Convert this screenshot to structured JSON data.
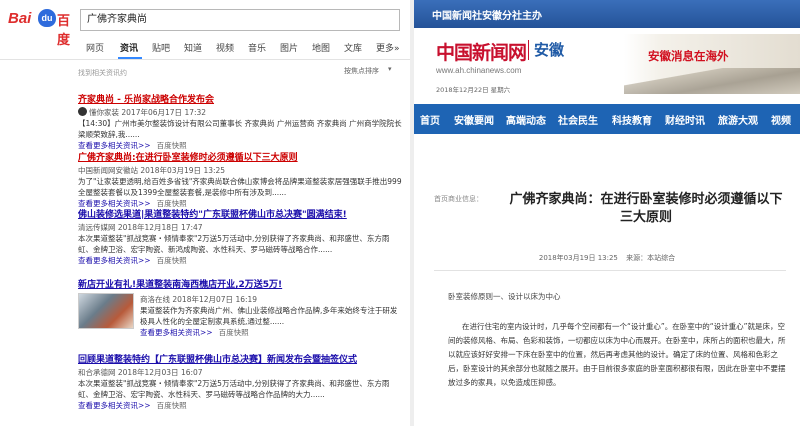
{
  "left": {
    "logo": {
      "bai": "Bai",
      "paw": "du",
      "du": "百度"
    },
    "search": {
      "value": "广佛齐家典尚"
    },
    "nav": [
      "网页",
      "资讯",
      "贴吧",
      "知道",
      "视频",
      "音乐",
      "图片",
      "地图",
      "文库",
      "更多»"
    ],
    "nav_active": "资讯",
    "result_meta": "找到相关资讯约",
    "sort": "按焦点排序",
    "sort_arrow": "▾",
    "results": [
      {
        "title": "齐家典尚 - 乐尚家战略合作发布会",
        "source": "懂你家装   2017年06月17日  17:32",
        "snippet": "【14:30】广州市美尔整装饰设计有限公司董事长 齐家典尚 广州运营商 齐家典尚 广州商学院院长 梁顺荣致辞,我......",
        "more": "查看更多相关资讯>>",
        "cache": "百度快照"
      },
      {
        "title": "广佛齐家典尚:在进行卧室装修时必须遵循以下三大原则",
        "source": "中国新闻网安徽站   2018年03月19日  13:25",
        "snippet": "为了\"让家装更透明,给百姓多省钱\"齐家典尚联合佛山家博会将品牌果道整装家居强强联手推出999全屋整装套餐以及1399全屋整装套餐,是装修中所有涉及到......",
        "more": "查看更多相关资讯>>",
        "cache": "百度快照"
      },
      {
        "title": "佛山装修选果道|果道整装特约\"广东联盟杯佛山市总决赛\"圆满结束!",
        "source": "清远传媒网   2018年12月18日  17:47",
        "snippet": "本次果道整装\"抓战竞赛・倾情奉家\"2万送5万活动中,分别获得了齐家典尚、和邦盛世、东方雨虹、金牌卫浴、宏宇陶瓷、新鸿成陶瓷、水性科天、罗马磁砖等战略合作......",
        "more": "查看更多相关资讯>>",
        "cache": "百度快照"
      },
      {
        "title": "新店开业有礼!果道整装南海西樵店开业,2万送5万!",
        "source": "商洛在线   2018年12月07日  16:19",
        "snippet": "果道整装作为齐家典尚广州、佛山业装修战略合作品牌,多年来始终专注于研发极具人性化的全屋定制家具系统,通过整......",
        "more": "查看更多相关资讯>>",
        "cache": "百度快照"
      },
      {
        "title": "回顾果道整装特约【广东联盟杯佛山市总决赛】新闻发布会暨抽签仪式",
        "source": "和合承德网   2018年12月03日  16:07",
        "snippet": "本次果道整装\"抓战竞赛・倾情奉家\"2万送5万活动中,分别获得了齐家典尚、和邦盛世、东方雨虹、金牌卫浴、宏宇陶瓷、水性科天、罗马磁砖等战略合作品牌的大力......",
        "more": "查看更多相关资讯>>",
        "cache": "百度快照"
      }
    ]
  },
  "right": {
    "topbar": "中国新闻社安徽分社主办",
    "logo": "中国新闻网",
    "province": "安徽",
    "url": "www.ah.chinanews.com",
    "date": "2018年12月22日  星期六",
    "banner": "安徽消息在海外",
    "nav": [
      "首页",
      "安徽要闻",
      "高端动态",
      "社会民生",
      "科技教育",
      "财经时讯",
      "旅游大观",
      "视频"
    ],
    "crumb": "首页商业信息：",
    "article": {
      "title": "广佛齐家典尚：在进行卧室装修时必须遵循以下三大原则",
      "date": "2018年03月19日 13:25",
      "source": "来源：本站综合",
      "subheading": "卧室装修原则一、设计以床为中心",
      "body": "在进行住宅的室内设计时，几乎每个空间都有一个“设计重心”。在卧室中的“设计重心”就是床，空间的装修风格、布局、色彩和装饰，一切都应以床为中心而展开。在卧室中，床所占的面积也最大，所以就应该好好安排一下床在卧室中的位置，然后再考虑其他的设计。确定了床的位置、风格和色彩之后，卧室设计的其余部分也就随之展开。由于目前很多家庭的卧室面积都很有限，因此在卧室中不要摆放过多的家具，以免造成压抑感。"
    }
  }
}
